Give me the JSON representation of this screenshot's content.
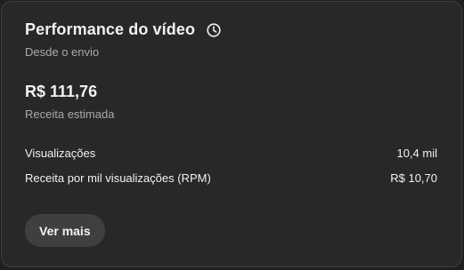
{
  "card": {
    "title": "Performance do vídeo",
    "title_icon": "clock-icon",
    "subtitle": "Desde o envio",
    "estimated_revenue": {
      "value": "R$ 111,76",
      "label": "Receita estimada"
    },
    "metrics": [
      {
        "label": "Visualizações",
        "value": "10,4 mil"
      },
      {
        "label": "Receita por mil visualizações (RPM)",
        "value": "R$ 10,70"
      }
    ],
    "more_button_label": "Ver mais"
  },
  "colors": {
    "background": "#1f1f1f",
    "card": "#282828",
    "text_primary": "#f1f1f1",
    "text_secondary": "#aaaaaa",
    "button": "#3f3f3f"
  }
}
